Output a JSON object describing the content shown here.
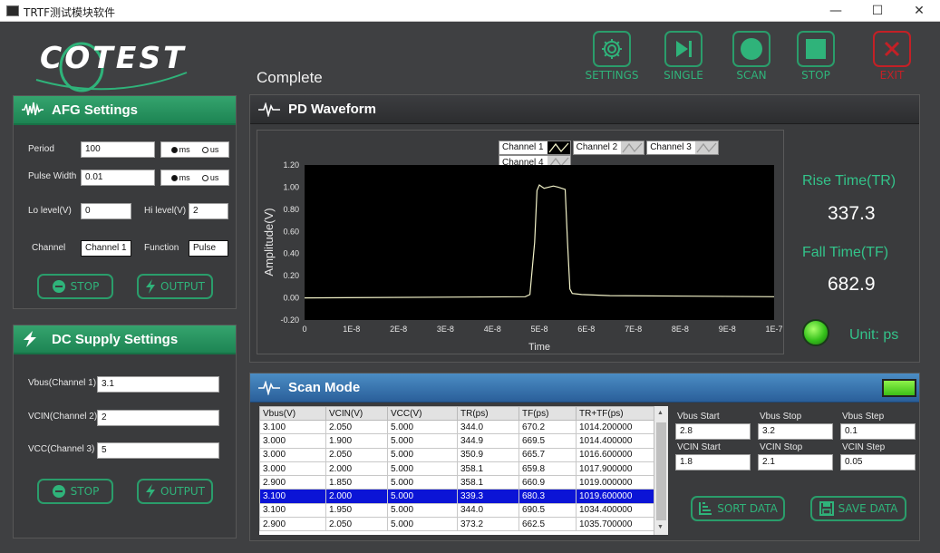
{
  "window": {
    "title": "TRTF测试模块软件",
    "minimize": "—",
    "maximize": "☐",
    "close": "✕"
  },
  "logo": {
    "text": "COTEST"
  },
  "status": "Complete",
  "toolbar": {
    "settings": "SETTINGS",
    "single": "SINGLE",
    "scan": "SCAN",
    "stop": "STOP",
    "exit": "EXIT",
    "accent": "#2a9d6b",
    "exit_color": "#c42026"
  },
  "afg": {
    "title": "AFG Settings",
    "period_label": "Period",
    "period_value": "100",
    "pulse_width_label": "Pulse Width",
    "pulse_width_value": "0.01",
    "unit_ms": "ms",
    "unit_us": "us",
    "lo_label": "Lo level(V)",
    "lo_value": "0",
    "hi_label": "Hi level(V)",
    "hi_value": "2",
    "channel_label": "Channel",
    "channel_value": "Channel 1",
    "function_label": "Function",
    "function_value": "Pulse",
    "stop_label": "STOP",
    "output_label": "OUTPUT"
  },
  "dc": {
    "title": "DC Supply Settings",
    "vbus_label": "Vbus(Channel 1)",
    "vbus_value": "3.1",
    "vcin_label": "VCIN(Channel 2)",
    "vcin_value": "2",
    "vcc_label": "VCC(Channel 3)",
    "vcc_value": "5",
    "stop_label": "STOP",
    "output_label": "OUTPUT"
  },
  "waveform": {
    "title": "PD Waveform",
    "legend": [
      "Channel 1",
      "Channel 2",
      "Channel 3",
      "Channel 4"
    ]
  },
  "chart_data": {
    "type": "line",
    "ylabel": "Amplitude(V)",
    "xlabel": "Time",
    "x_ticks": [
      "0",
      "1E-8",
      "2E-8",
      "3E-8",
      "4E-8",
      "5E-8",
      "6E-8",
      "7E-8",
      "8E-8",
      "9E-8",
      "1E-7"
    ],
    "y_ticks": [
      "1.20",
      "1.00",
      "0.80",
      "0.60",
      "0.40",
      "0.20",
      "0.00",
      "-0.20"
    ],
    "xlim": [
      0,
      1e-07
    ],
    "ylim": [
      -0.2,
      1.2
    ],
    "grid": false,
    "legend_position": "top-right",
    "series": [
      {
        "name": "Channel 1",
        "color": "#f2f2c8",
        "points": [
          [
            0,
            0.0
          ],
          [
            4.7e-08,
            0.01
          ],
          [
            4.8e-08,
            0.03
          ],
          [
            4.9e-08,
            0.5
          ],
          [
            4.95e-08,
            0.97
          ],
          [
            5e-08,
            1.02
          ],
          [
            5.1e-08,
            0.99
          ],
          [
            5.3e-08,
            1.01
          ],
          [
            5.4e-08,
            1.0
          ],
          [
            5.55e-08,
            0.98
          ],
          [
            5.6e-08,
            0.5
          ],
          [
            5.65e-08,
            0.08
          ],
          [
            5.7e-08,
            0.04
          ],
          [
            5.9e-08,
            0.03
          ],
          [
            6.5e-08,
            0.02
          ],
          [
            1e-07,
            0.01
          ]
        ]
      }
    ]
  },
  "results": {
    "rise_label": "Rise Time(TR)",
    "rise_value": "337.3",
    "fall_label": "Fall Time(TF)",
    "fall_value": "682.9",
    "unit_label": "Unit:  ps"
  },
  "scan": {
    "title": "Scan Mode",
    "columns": [
      "Vbus(V)",
      "VCIN(V)",
      "VCC(V)",
      "TR(ps)",
      "TF(ps)",
      "TR+TF(ps)"
    ],
    "rows": [
      [
        "3.100",
        "2.050",
        "5.000",
        "344.0",
        "670.2",
        "1014.200000"
      ],
      [
        "3.000",
        "1.900",
        "5.000",
        "344.9",
        "669.5",
        "1014.400000"
      ],
      [
        "3.000",
        "2.050",
        "5.000",
        "350.9",
        "665.7",
        "1016.600000"
      ],
      [
        "3.000",
        "2.000",
        "5.000",
        "358.1",
        "659.8",
        "1017.900000"
      ],
      [
        "2.900",
        "1.850",
        "5.000",
        "358.1",
        "660.9",
        "1019.000000"
      ],
      [
        "3.100",
        "2.000",
        "5.000",
        "339.3",
        "680.3",
        "1019.600000"
      ],
      [
        "3.100",
        "1.950",
        "5.000",
        "344.0",
        "690.5",
        "1034.400000"
      ],
      [
        "2.900",
        "2.050",
        "5.000",
        "373.2",
        "662.5",
        "1035.700000"
      ]
    ],
    "selected_row": 5,
    "vbus_start_label": "Vbus Start",
    "vbus_start_value": "2.8",
    "vbus_stop_label": "Vbus Stop",
    "vbus_stop_value": "3.2",
    "vbus_step_label": "Vbus Step",
    "vbus_step_value": "0.1",
    "vcin_start_label": "VCIN Start",
    "vcin_start_value": "1.8",
    "vcin_stop_label": "VCIN Stop",
    "vcin_stop_value": "2.1",
    "vcin_step_label": "VCIN Step",
    "vcin_step_value": "0.05",
    "sort_label": "SORT DATA",
    "save_label": "SAVE DATA"
  }
}
